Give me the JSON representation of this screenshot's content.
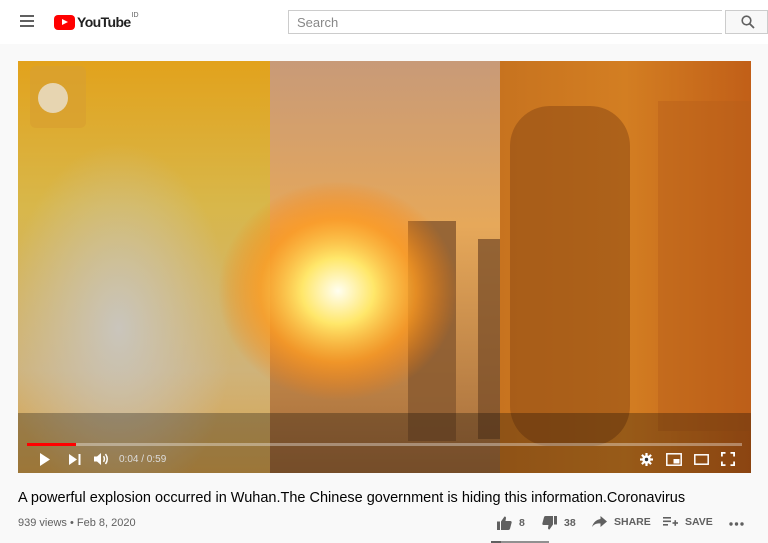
{
  "header": {
    "logo_text": "YouTube",
    "country_code": "ID",
    "search": {
      "placeholder": "Search",
      "value": ""
    }
  },
  "player": {
    "time_display": "0:04 / 0:59",
    "progress": 0.068,
    "accent_color": "#ff0000"
  },
  "video": {
    "title": "A powerful explosion occurred in Wuhan.The Chinese government is hiding this information.Coronavirus",
    "meta": "939 views • Feb 8, 2020"
  },
  "actions": {
    "like_count": "8",
    "dislike_count": "38",
    "share_label": "SHARE",
    "save_label": "SAVE",
    "like_ratio": 0.17
  },
  "icons": [
    "menu-icon",
    "youtube-logo-icon",
    "search-icon",
    "play-icon",
    "next-icon",
    "volume-icon",
    "settings-icon",
    "miniplayer-icon",
    "theater-icon",
    "fullscreen-icon",
    "thumbs-up-icon",
    "thumbs-down-icon",
    "share-icon",
    "playlist-add-icon",
    "more-icon"
  ]
}
